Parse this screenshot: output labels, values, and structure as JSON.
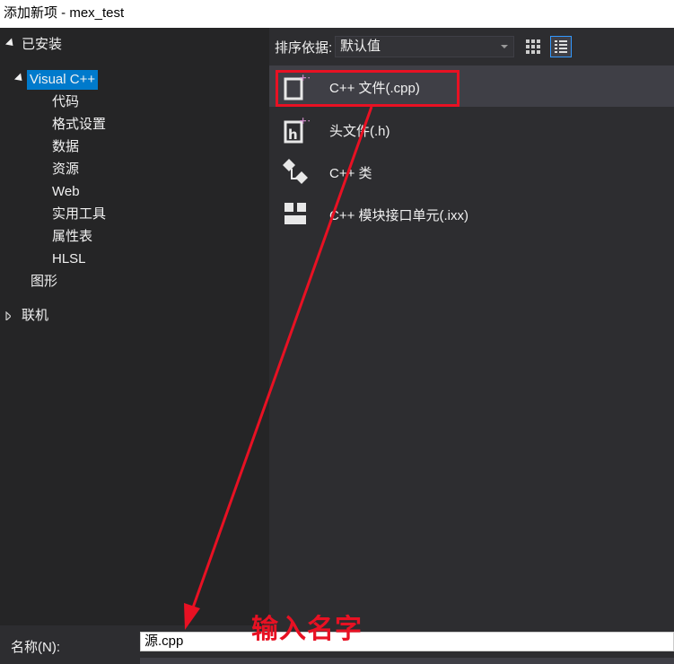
{
  "window": {
    "title": "添加新项 - mex_test"
  },
  "tree": {
    "installed": "已安装",
    "visual_cpp": "Visual C++",
    "children": [
      "代码",
      "格式设置",
      "数据",
      "资源",
      "Web",
      "实用工具",
      "属性表",
      "HLSL"
    ],
    "graphics": "图形",
    "online": "联机"
  },
  "sort": {
    "label": "排序依据:",
    "value": "默认值"
  },
  "items": [
    {
      "label": "C++ 文件(.cpp)",
      "icon": "cpp-file-icon"
    },
    {
      "label": "头文件(.h)",
      "icon": "header-file-icon"
    },
    {
      "label": "C++ 类",
      "icon": "cpp-class-icon"
    },
    {
      "label": "C++ 模块接口单元(.ixx)",
      "icon": "module-interface-icon"
    }
  ],
  "bottom": {
    "name_label": "名称(N):",
    "name_value": "源.cpp"
  },
  "annotation": {
    "text": "输入名字",
    "color": "#e81123"
  },
  "colors": {
    "accent": "#007acc",
    "annotation": "#e81123",
    "panel": "#2d2d30"
  }
}
